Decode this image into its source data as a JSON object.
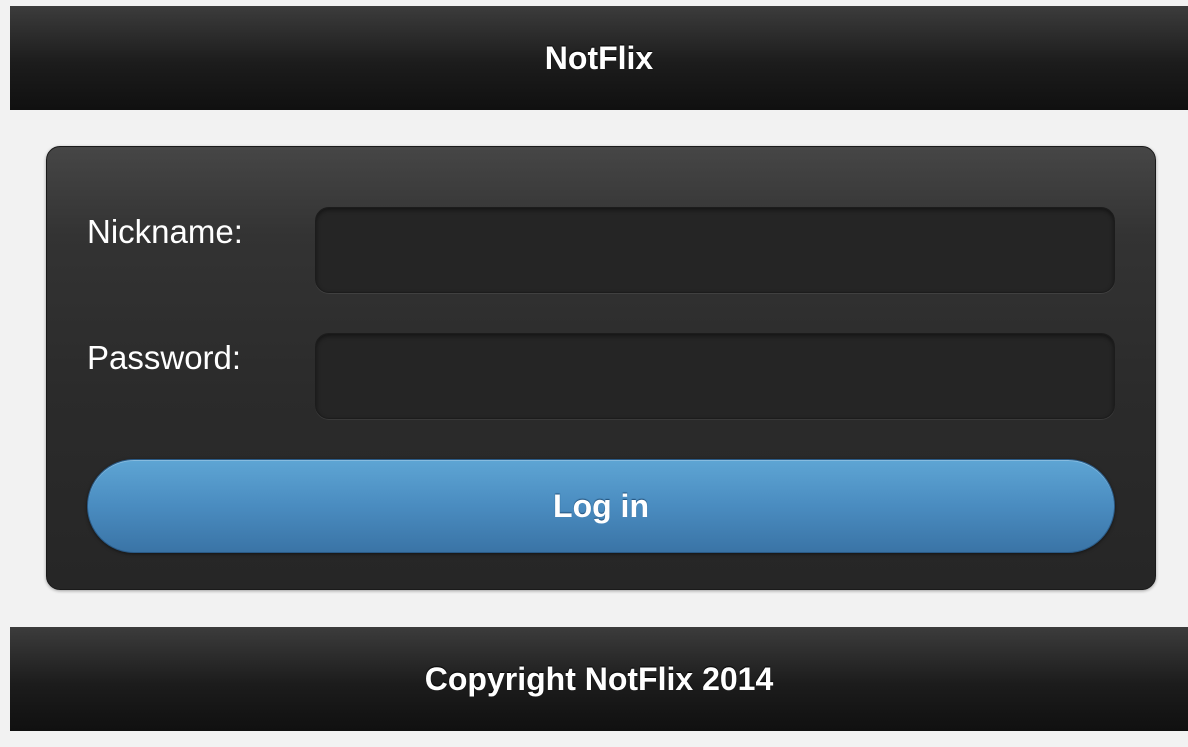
{
  "header": {
    "title": "NotFlix"
  },
  "login_form": {
    "nickname_label": "Nickname:",
    "nickname_value": "",
    "password_label": "Password:",
    "password_value": "",
    "login_button_label": "Log in"
  },
  "footer": {
    "text": "Copyright NotFlix 2014"
  },
  "colors": {
    "page_background": "#f2f2f2",
    "bar_background": "#1c1c1c",
    "panel_background": "#2b2b2b",
    "input_background": "#252525",
    "button_accent": "#4a8cc0",
    "text": "#ffffff"
  }
}
